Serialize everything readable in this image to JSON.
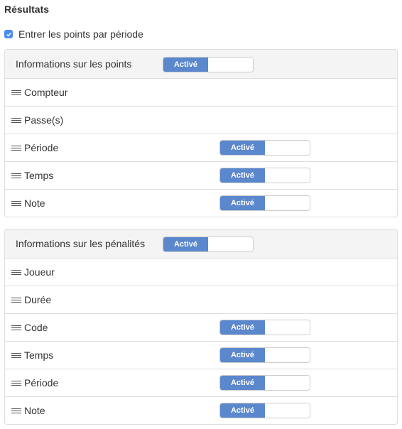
{
  "title": "Résultats",
  "period_checkbox": {
    "label": "Entrer les points par période",
    "checked": true
  },
  "points_panel": {
    "header": {
      "label": "Informations sur les points",
      "toggle": "Activé"
    },
    "rows": [
      {
        "label": "Compteur",
        "toggle": null
      },
      {
        "label": "Passe(s)",
        "toggle": null
      },
      {
        "label": "Période",
        "toggle": "Activé"
      },
      {
        "label": "Temps",
        "toggle": "Activé"
      },
      {
        "label": "Note",
        "toggle": "Activé"
      }
    ]
  },
  "penalties_panel": {
    "header": {
      "label": "Informations sur les pénalités",
      "toggle": "Activé"
    },
    "rows": [
      {
        "label": "Joueur",
        "toggle": null
      },
      {
        "label": "Durée",
        "toggle": null
      },
      {
        "label": "Code",
        "toggle": "Activé"
      },
      {
        "label": "Temps",
        "toggle": "Activé"
      },
      {
        "label": "Période",
        "toggle": "Activé"
      },
      {
        "label": "Note",
        "toggle": "Activé"
      }
    ]
  },
  "colors": {
    "toggle_on": "#5b87cd",
    "checkbox": "#4a8cf0",
    "header_bg": "#f4f4f4"
  }
}
